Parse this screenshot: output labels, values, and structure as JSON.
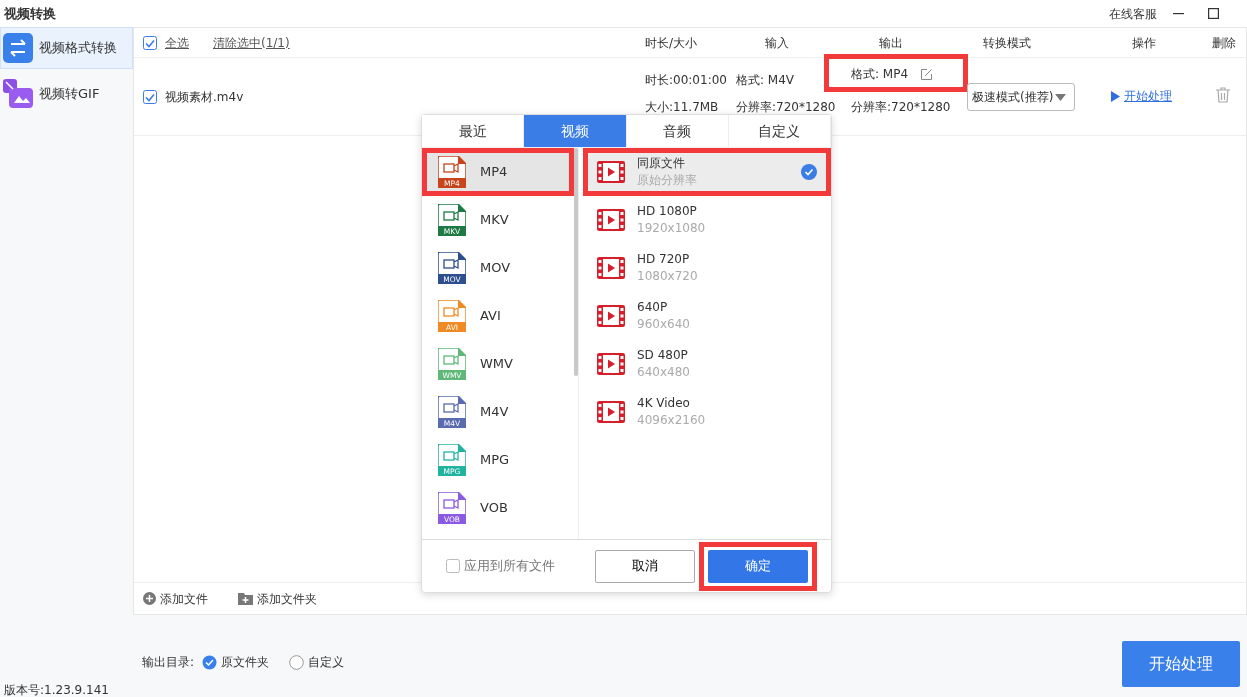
{
  "window": {
    "title": "视频转换",
    "support": "在线客服"
  },
  "sidebar": {
    "items": [
      {
        "label": "视频格式转换",
        "kind": "convert",
        "selected": true
      },
      {
        "label": "视频转GIF",
        "kind": "gif",
        "selected": false
      }
    ]
  },
  "toolbar": {
    "select_all": {
      "label": "全选",
      "checked": true
    },
    "clear": "清除选中(1/1)"
  },
  "table": {
    "columns": [
      "时长/大小",
      "输入",
      "输出",
      "转换模式",
      "操作",
      "删除"
    ],
    "rows": [
      {
        "checked": true,
        "name": "视频素材.m4v",
        "duration": "时长:00:01:00",
        "size": "大小:11.7MB",
        "input_format": "格式: M4V",
        "input_resolution": "分辨率:720*1280",
        "output_format": "格式: MP4",
        "output_resolution": "分辨率:720*1280",
        "output_highlighted": true,
        "mode": "极速模式(推荐)",
        "action": "开始处理"
      }
    ]
  },
  "format_dialog": {
    "tabs": [
      {
        "label": "最近",
        "selected": false
      },
      {
        "label": "视频",
        "selected": true
      },
      {
        "label": "音频",
        "selected": false
      },
      {
        "label": "自定义",
        "selected": false
      }
    ],
    "formats": [
      {
        "name": "MP4",
        "tag": "MP4",
        "color": "#c8441c",
        "selected": true,
        "highlighted": true
      },
      {
        "name": "MKV",
        "tag": "MKV",
        "color": "#1e7a45",
        "selected": false,
        "highlighted": false
      },
      {
        "name": "MOV",
        "tag": "MOV",
        "color": "#2d4f8e",
        "selected": false,
        "highlighted": false
      },
      {
        "name": "AVI",
        "tag": "AVI",
        "color": "#f08a24",
        "selected": false,
        "highlighted": false
      },
      {
        "name": "WMV",
        "tag": "WMV",
        "color": "#5fb878",
        "selected": false,
        "highlighted": false
      },
      {
        "name": "M4V",
        "tag": "M4V",
        "color": "#5a6bb0",
        "selected": false,
        "highlighted": false
      },
      {
        "name": "MPG",
        "tag": "MPG",
        "color": "#22b3a0",
        "selected": false,
        "highlighted": false
      },
      {
        "name": "VOB",
        "tag": "VOB",
        "color": "#8a5ae0",
        "selected": false,
        "highlighted": false
      }
    ],
    "presets": [
      {
        "title": "同原文件",
        "subtitle": "原始分辨率",
        "selected": true,
        "highlighted": true
      },
      {
        "title": "HD 1080P",
        "subtitle": "1920x1080",
        "selected": false,
        "highlighted": false
      },
      {
        "title": "HD 720P",
        "subtitle": "1080x720",
        "selected": false,
        "highlighted": false
      },
      {
        "title": "640P",
        "subtitle": "960x640",
        "selected": false,
        "highlighted": false
      },
      {
        "title": "SD 480P",
        "subtitle": "640x480",
        "selected": false,
        "highlighted": false
      },
      {
        "title": "4K Video",
        "subtitle": "4096x2160",
        "selected": false,
        "highlighted": false
      }
    ],
    "apply_all": {
      "label": "应用到所有文件",
      "checked": false
    },
    "cancel": "取消",
    "confirm": "确定",
    "confirm_highlighted": true
  },
  "file_bar": [
    {
      "label": "添加文件",
      "kind": "file"
    },
    {
      "label": "添加文件夹",
      "kind": "folder"
    }
  ],
  "output_dir": {
    "label": "输出目录:",
    "options": [
      {
        "label": "原文件夹",
        "selected": true
      },
      {
        "label": "自定义",
        "selected": false
      }
    ]
  },
  "start_button": "开始处理",
  "version": "版本号:1.23.9.141"
}
